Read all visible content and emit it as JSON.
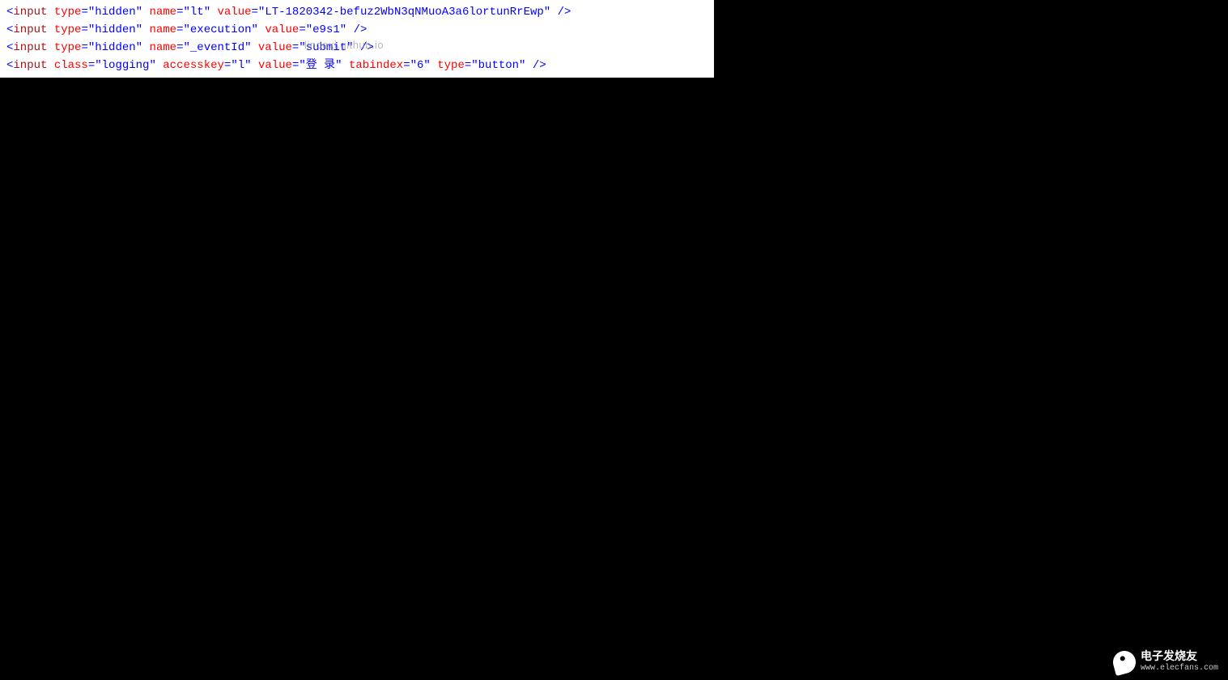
{
  "code": {
    "lines": [
      {
        "tag": "input",
        "attrs": [
          {
            "name": "type",
            "value": "hidden"
          },
          {
            "name": "name",
            "value": "lt"
          },
          {
            "name": "value",
            "value": "LT-1820342-befuz2WbN3qNMuoA3a6lortunRrEwp"
          }
        ]
      },
      {
        "tag": "input",
        "attrs": [
          {
            "name": "type",
            "value": "hidden"
          },
          {
            "name": "name",
            "value": "execution"
          },
          {
            "name": "value",
            "value": "e9s1"
          }
        ]
      },
      {
        "tag": "input",
        "attrs": [
          {
            "name": "type",
            "value": "hidden"
          },
          {
            "name": "name",
            "value": "_eventId"
          },
          {
            "name": "value",
            "value": "submit"
          }
        ]
      },
      {
        "tag": "input",
        "attrs": [
          {
            "name": "class",
            "value": "logging"
          },
          {
            "name": "accesskey",
            "value": "l"
          },
          {
            "name": "value",
            "value": "登 录"
          },
          {
            "name": "tabindex",
            "value": "6"
          },
          {
            "name": "type",
            "value": "button"
          }
        ]
      }
    ]
  },
  "watermark": {
    "overlay_text": "lindexi.github.io",
    "logo_title": "电子发烧友",
    "logo_url": "www.elecfans.com"
  }
}
